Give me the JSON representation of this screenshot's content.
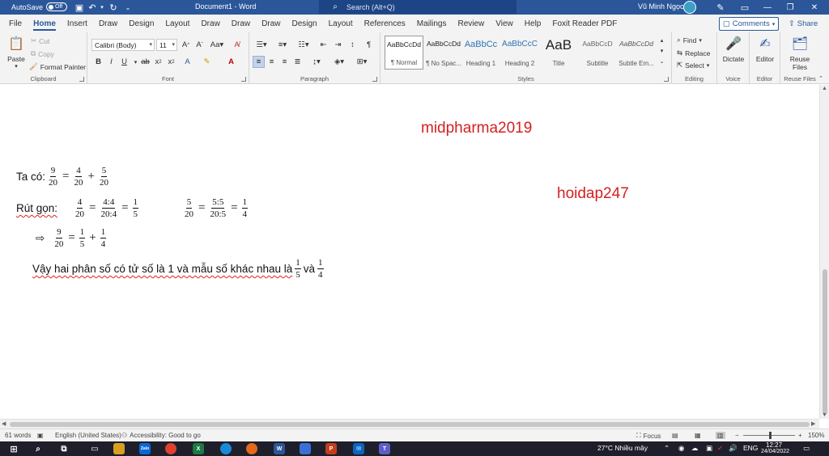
{
  "titlebar": {
    "autosave": "AutoSave",
    "autosave_state": "Off",
    "doc_title": "Document1 - Word",
    "search_placeholder": "Search (Alt+Q)",
    "user": "Vũ Minh Ngọc"
  },
  "tabs": [
    "File",
    "Home",
    "Insert",
    "Draw",
    "Design",
    "Layout",
    "Draw",
    "Draw",
    "Draw",
    "Design",
    "Layout",
    "References",
    "Mailings",
    "Review",
    "View",
    "Help",
    "Foxit Reader PDF"
  ],
  "active_tab": "Home",
  "comments_label": "Comments",
  "share_label": "Share",
  "ribbon": {
    "clipboard": {
      "paste": "Paste",
      "cut": "Cut",
      "copy": "Copy",
      "format_painter": "Format Painter",
      "label": "Clipboard"
    },
    "font": {
      "name": "Calibri (Body)",
      "size": "11",
      "label": "Font"
    },
    "paragraph": {
      "label": "Paragraph"
    },
    "styles": {
      "items": [
        {
          "preview": "AaBbCcDd",
          "name": "¶ Normal"
        },
        {
          "preview": "AaBbCcDd",
          "name": "¶ No Spac..."
        },
        {
          "preview": "AaBbCc",
          "name": "Heading 1"
        },
        {
          "preview": "AaBbCcC",
          "name": "Heading 2"
        },
        {
          "preview": "AaB",
          "name": "Title"
        },
        {
          "preview": "AaBbCcD",
          "name": "Subtitle"
        },
        {
          "preview": "AaBbCcDd",
          "name": "Subtle Em..."
        }
      ],
      "label": "Styles"
    },
    "editing": {
      "find": "Find",
      "replace": "Replace",
      "select": "Select",
      "label": "Editing"
    },
    "voice": {
      "dictate": "Dictate",
      "label": "Voice"
    },
    "editor": {
      "editor": "Editor",
      "label": "Editor"
    },
    "reuse": {
      "reuse_files_line1": "Reuse",
      "reuse_files_line2": "Files",
      "label": "Reuse Files"
    }
  },
  "document": {
    "watermark1": "midpharma2019",
    "watermark2": "hoidap247",
    "line1_label": "Ta có:",
    "line2_label": "Rút gọn:",
    "arrow": "⇨",
    "conclusion": "Vậy hai phân số có tử số là 1 và mẫu số khác nhau là",
    "conclusion_and": "và",
    "fractions": {
      "f9_20": {
        "num": "9",
        "den": "20"
      },
      "f4_20": {
        "num": "4",
        "den": "20"
      },
      "f5_20": {
        "num": "5",
        "den": "20"
      },
      "f44_204": {
        "num": "4:4",
        "den": "20:4"
      },
      "f55_205": {
        "num": "5:5",
        "den": "20:5"
      },
      "f1_5": {
        "num": "1",
        "den": "5"
      },
      "f1_4": {
        "num": "1",
        "den": "4"
      }
    },
    "eq": "=",
    "plus": "+"
  },
  "statusbar": {
    "words": "61 words",
    "language": "English (United States)",
    "accessibility": "Accessibility: Good to go",
    "focus": "Focus",
    "zoom": "150%"
  },
  "taskbar": {
    "weather": "27°C  Nhiều mây",
    "lang": "ENG",
    "time": "12:27",
    "date": "24/04/2022"
  }
}
